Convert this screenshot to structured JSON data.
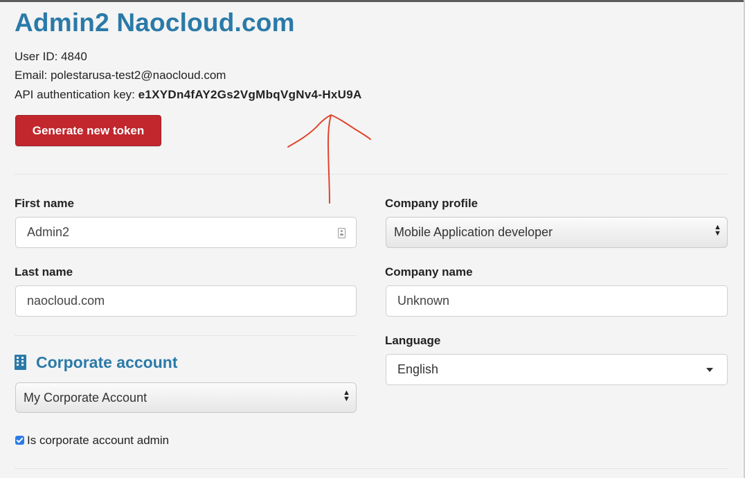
{
  "profile": {
    "title": "Admin2 Naocloud.com",
    "user_id": "User ID: 4840",
    "email": "Email: polestarusa-test2@naocloud.com",
    "api_key_label": "API authentication key: ",
    "api_key_value": "e1XYDn4fAY2Gs2VgMbqVgNv4-HxU9A",
    "generate_button": "Generate new token"
  },
  "form": {
    "first_name_label": "First name",
    "first_name_value": "Admin2",
    "last_name_label": "Last name",
    "last_name_value": "naocloud.com",
    "company_profile_label": "Company profile",
    "company_profile_value": "Mobile Application developer",
    "company_name_label": "Company name",
    "company_name_placeholder": "Unknown",
    "language_label": "Language",
    "language_value": "English"
  },
  "corporate": {
    "title": "Corporate account",
    "account_value": "My Corporate Account",
    "admin_checkbox_label": "Is corporate account admin",
    "admin_checked": true
  },
  "annotation": {
    "color": "#e0432a",
    "type": "hand-drawn-arrow"
  },
  "colors": {
    "accent": "#2a7aa8",
    "danger": "#c1272d",
    "checkbox": "#2d7be5"
  }
}
